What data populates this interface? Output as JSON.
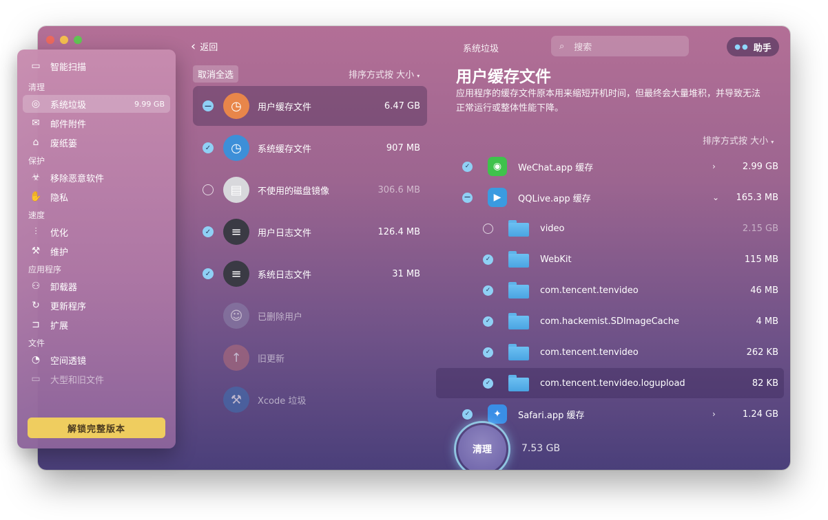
{
  "sidebar": {
    "top_item": {
      "label": "智能扫描",
      "icon": "monitor-icon"
    },
    "sections": [
      {
        "title": "清理",
        "items": [
          {
            "label": "系统垃圾",
            "icon": "trash-icon",
            "size": "9.99 GB",
            "active": true
          },
          {
            "label": "邮件附件",
            "icon": "mail-icon"
          },
          {
            "label": "废纸篓",
            "icon": "bin-icon"
          }
        ]
      },
      {
        "title": "保护",
        "items": [
          {
            "label": "移除恶意软件",
            "icon": "biohazard-icon"
          },
          {
            "label": "隐私",
            "icon": "hand-icon"
          }
        ]
      },
      {
        "title": "速度",
        "items": [
          {
            "label": "优化",
            "icon": "sliders-icon"
          },
          {
            "label": "维护",
            "icon": "wrench-icon"
          }
        ]
      },
      {
        "title": "应用程序",
        "items": [
          {
            "label": "卸载器",
            "icon": "uninstaller-icon"
          },
          {
            "label": "更新程序",
            "icon": "updater-icon"
          },
          {
            "label": "扩展",
            "icon": "extension-icon"
          }
        ]
      },
      {
        "title": "文件",
        "items": [
          {
            "label": "空间透镜",
            "icon": "lens-icon"
          },
          {
            "label": "大型和旧文件",
            "icon": "folder-icon"
          }
        ]
      }
    ],
    "unlock_label": "解锁完整版本"
  },
  "header": {
    "back_label": "返回",
    "title": "系统垃圾",
    "search_placeholder": "搜索",
    "assistant_label": "助手"
  },
  "middle": {
    "deselect_all": "取消全选",
    "sort_label": "排序方式按 大小",
    "categories": [
      {
        "name": "用户缓存文件",
        "size": "6.47 GB",
        "state": "mixed",
        "icon": "user-cache-icon",
        "color": "#e8864a"
      },
      {
        "name": "系统缓存文件",
        "size": "907 MB",
        "state": "on",
        "icon": "system-cache-icon",
        "color": "#3d8fd8"
      },
      {
        "name": "不使用的磁盘镜像",
        "size": "306.6 MB",
        "state": "off",
        "icon": "disk-image-icon",
        "color": "#d8d8dc"
      },
      {
        "name": "用户日志文件",
        "size": "126.4 MB",
        "state": "on",
        "icon": "user-log-icon",
        "color": "#3a3a44"
      },
      {
        "name": "系统日志文件",
        "size": "31 MB",
        "state": "on",
        "icon": "system-log-icon",
        "color": "#3a3a44"
      },
      {
        "name": "已删除用户",
        "size": "",
        "state": "none",
        "icon": "deleted-user-icon",
        "color": "#8a80a8"
      },
      {
        "name": "旧更新",
        "size": "",
        "state": "none",
        "icon": "old-update-icon",
        "color": "#b06c7a"
      },
      {
        "name": "Xcode 垃圾",
        "size": "",
        "state": "none",
        "icon": "xcode-icon",
        "color": "#3f6fb0"
      }
    ]
  },
  "detail": {
    "title": "用户缓存文件",
    "description": "应用程序的缓存文件原本用来缩短开机时间，但最终会大量堆积，并导致无法正常运行或整体性能下降。",
    "sort_label": "排序方式按 大小",
    "files": [
      {
        "name": "WeChat.app 缓存",
        "size": "2.99 GB",
        "state": "on",
        "type": "app",
        "icon": "wechat-icon",
        "color": "#3fc24c",
        "arrow": "›"
      },
      {
        "name": "QQLive.app 缓存",
        "size": "165.3 MB",
        "state": "mixed",
        "type": "app",
        "icon": "qqlive-icon",
        "color": "#3a9be0",
        "arrow": "⌄"
      },
      {
        "name": "video",
        "size": "2.15 GB",
        "state": "off",
        "type": "folder",
        "icon": "folder-icon",
        "dim": true
      },
      {
        "name": "WebKit",
        "size": "115 MB",
        "state": "on",
        "type": "folder",
        "icon": "folder-icon"
      },
      {
        "name": "com.tencent.tenvideo",
        "size": "46 MB",
        "state": "on",
        "type": "folder",
        "icon": "folder-icon"
      },
      {
        "name": "com.hackemist.SDImageCache",
        "size": "4 MB",
        "state": "on",
        "type": "folder",
        "icon": "folder-icon"
      },
      {
        "name": "com.tencent.tenvideo",
        "size": "262 KB",
        "state": "on",
        "type": "folder",
        "icon": "folder-icon"
      },
      {
        "name": "com.tencent.tenvideo.logupload",
        "size": "82 KB",
        "state": "on",
        "type": "folder",
        "icon": "folder-icon",
        "active": true
      },
      {
        "name": "Safari.app 缓存",
        "size": "1.24 GB",
        "state": "on",
        "type": "app",
        "icon": "safari-icon",
        "color": "#3a8ee6",
        "arrow": "›"
      }
    ]
  },
  "footer": {
    "clean_label": "清理",
    "total": "7.53 GB"
  }
}
